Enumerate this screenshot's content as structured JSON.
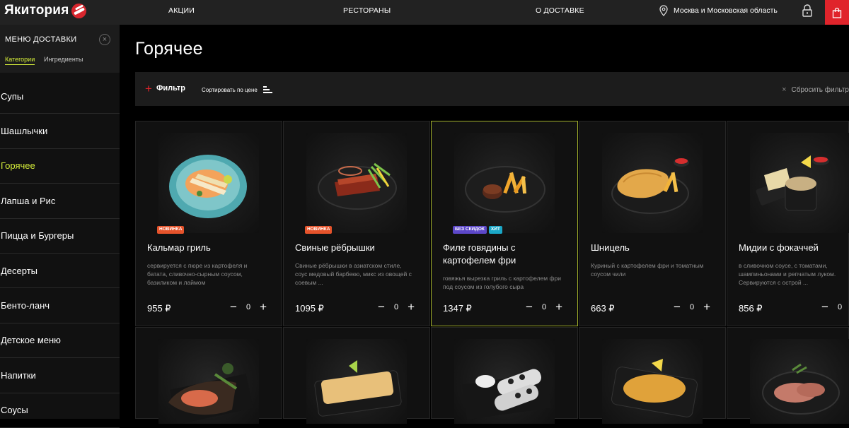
{
  "header": {
    "logo_text": "Якитория",
    "nav": [
      "АКЦИИ",
      "РЕСТОРАНЫ",
      "О ДОСТАВКЕ"
    ],
    "region": "Москва и Московская область",
    "accent_color": "#e0242b"
  },
  "sidebar": {
    "title": "МЕНЮ ДОСТАВКИ",
    "close_glyph": "×",
    "tabs": [
      "Категории",
      "Ингредиенты"
    ],
    "items": [
      {
        "label": "Супы"
      },
      {
        "label": "Шашлычки"
      },
      {
        "label": "Горячее",
        "active": true
      },
      {
        "label": "Лапша и Рис"
      },
      {
        "label": "Пицца и Бургеры"
      },
      {
        "label": "Десерты"
      },
      {
        "label": "Бенто-ланч"
      },
      {
        "label": "Детское меню"
      },
      {
        "label": "Напитки"
      },
      {
        "label": "Соусы"
      }
    ],
    "active_color": "#d7ef3a"
  },
  "main": {
    "title": "Горячее",
    "filter_label": "Фильтр",
    "sort_label": "Сортировать по цене",
    "reset_label": "Сбросить фильтр"
  },
  "products": [
    {
      "name": "Кальмар гриль",
      "description": "сервируется с пюре из картофеля и батата, сливочно-сырным соусом, базиликом и лаймом",
      "price": "955 ₽",
      "qty": "0",
      "badges": [
        {
          "text": "НОВИНКА",
          "kind": "new"
        }
      ]
    },
    {
      "name": "Свиные рёбрышки",
      "description": "Свиные рёбрышки в азиатском стиле, соус медовый барбекю, микс из овощей с соевым ...",
      "price": "1095 ₽",
      "qty": "0",
      "badges": [
        {
          "text": "НОВИНКА",
          "kind": "new"
        }
      ]
    },
    {
      "name": "Филе говядины с картофелем фри",
      "description": "говяжья вырезка гриль с картофелем фри под соусом из голубого сыра",
      "price": "1347 ₽",
      "qty": "0",
      "selected": true,
      "badges": [
        {
          "text": "БЕЗ СКИДОК",
          "kind": "discount"
        },
        {
          "text": "ХИТ",
          "kind": "hit"
        }
      ]
    },
    {
      "name": "Шницель",
      "description": "Куриный с картофелем фри и томатным соусом чили",
      "price": "663 ₽",
      "qty": "0",
      "badges": []
    },
    {
      "name": "Мидии с фокаччей",
      "description": "в сливочном соусе, с томатами, шампиньонами и репчатым луком. Сервируются с острой ...",
      "price": "856 ₽",
      "qty": "0",
      "badges": []
    }
  ],
  "quantity_controls": {
    "minus": "−",
    "plus": "+"
  }
}
